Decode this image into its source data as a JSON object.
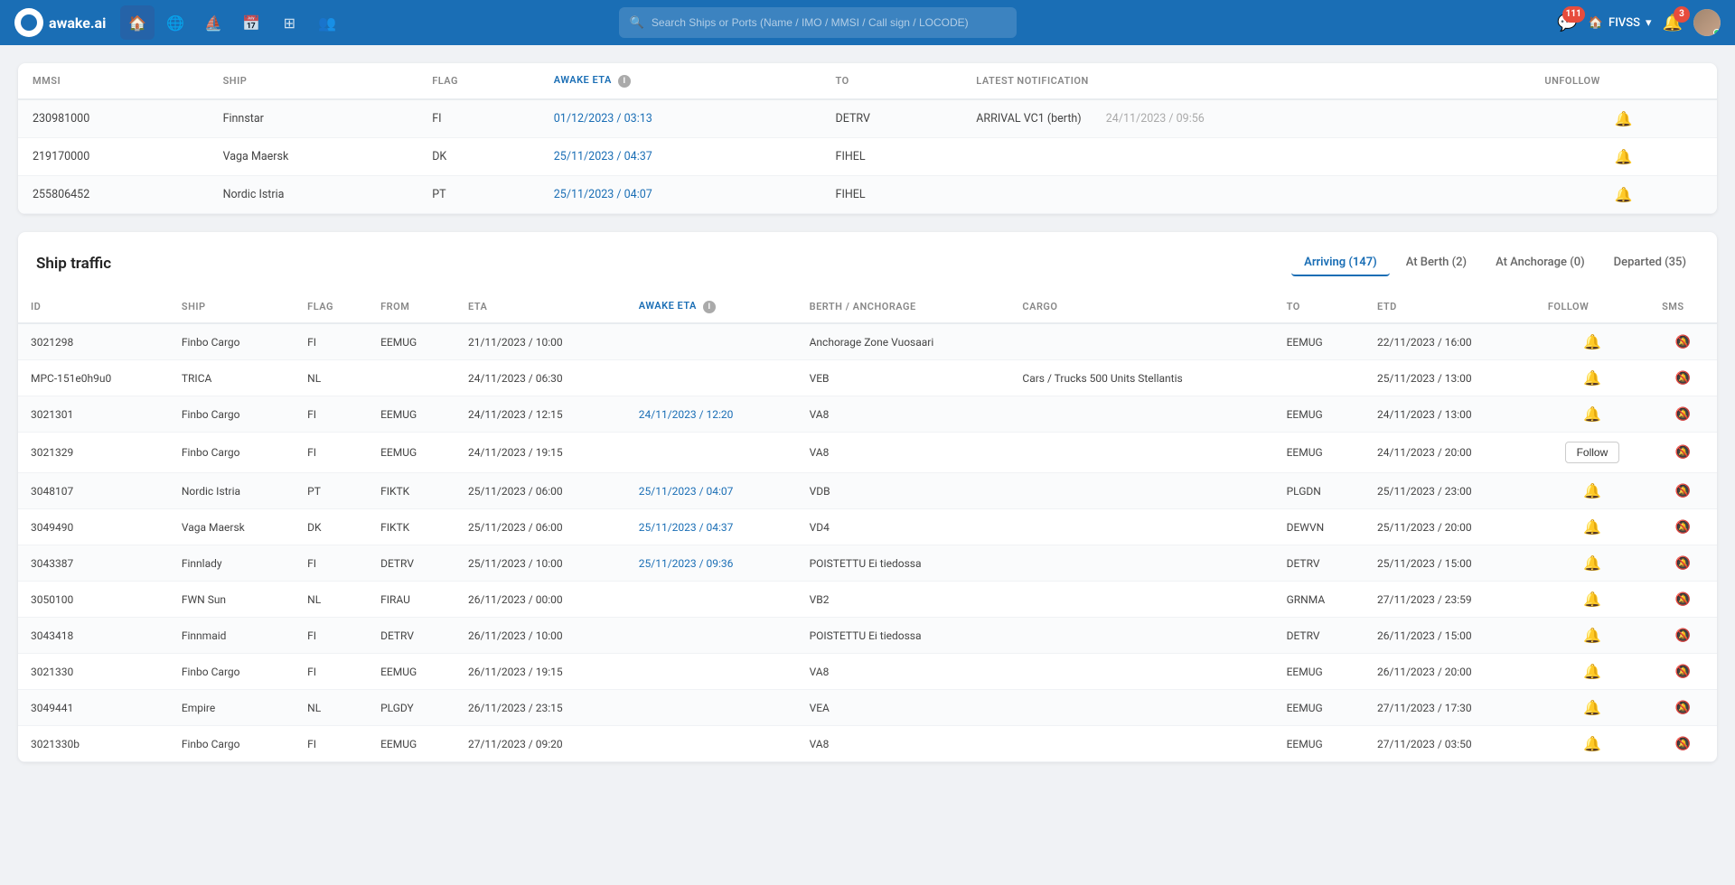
{
  "nav": {
    "logo_text": "awake.ai",
    "search_placeholder": "Search Ships or Ports (Name / IMO / MMSI / Call sign / LOCODE)",
    "notification_count": "111",
    "bell_count": "3",
    "workspace": "FIVSS"
  },
  "followed_table": {
    "columns": [
      "MMSI",
      "SHIP",
      "FLAG",
      "AWAKE ETA",
      "TO",
      "LATEST NOTIFICATION",
      "UNFOLLOW"
    ],
    "rows": [
      {
        "mmsi": "230981000",
        "ship": "Finnstar",
        "flag": "FI",
        "eta": "01/12/2023 / 03:13",
        "to": "DETRV",
        "notification": "ARRIVAL VC1 (berth)",
        "notif_time": "24/11/2023 / 09:56",
        "has_bell_active": true
      },
      {
        "mmsi": "219170000",
        "ship": "Vaga Maersk",
        "flag": "DK",
        "eta": "25/11/2023 / 04:37",
        "to": "FIHEL",
        "notification": "",
        "notif_time": "",
        "has_bell_active": false
      },
      {
        "mmsi": "255806452",
        "ship": "Nordic Istria",
        "flag": "PT",
        "eta": "25/11/2023 / 04:07",
        "to": "FIHEL",
        "notification": "",
        "notif_time": "",
        "has_bell_active": false
      }
    ]
  },
  "ship_traffic": {
    "title": "Ship traffic",
    "tabs": [
      {
        "label": "Arriving (147)",
        "active": true
      },
      {
        "label": "At Berth (2)",
        "active": false
      },
      {
        "label": "At Anchorage (0)",
        "active": false
      },
      {
        "label": "Departed (35)",
        "active": false
      }
    ],
    "columns": [
      "ID",
      "SHIP",
      "FLAG",
      "FROM",
      "ETA",
      "AWAKE ETA",
      "BERTH / ANCHORAGE",
      "CARGO",
      "TO",
      "ETD",
      "FOLLOW",
      "SMS"
    ],
    "rows": [
      {
        "id": "3021298",
        "ship": "Finbo Cargo",
        "flag": "FI",
        "from": "EEMUG",
        "eta": "21/11/2023 / 10:00",
        "awake_eta": "",
        "berth": "Anchorage Zone Vuosaari",
        "cargo": "",
        "to": "EEMUG",
        "etd": "22/11/2023 / 16:00",
        "follow_btn": false
      },
      {
        "id": "MPC-151e0h9u0",
        "ship": "TRICA",
        "flag": "NL",
        "from": "",
        "eta": "24/11/2023 / 06:30",
        "awake_eta": "",
        "berth": "VEB",
        "cargo": "Cars / Trucks 500 Units Stellantis",
        "to": "",
        "etd": "25/11/2023 / 13:00",
        "follow_btn": false
      },
      {
        "id": "3021301",
        "ship": "Finbo Cargo",
        "flag": "FI",
        "from": "EEMUG",
        "eta": "24/11/2023 / 12:15",
        "awake_eta": "24/11/2023 / 12:20",
        "berth": "VA8",
        "cargo": "",
        "to": "EEMUG",
        "etd": "24/11/2023 / 13:00",
        "follow_btn": false
      },
      {
        "id": "3021329",
        "ship": "Finbo Cargo",
        "flag": "FI",
        "from": "EEMUG",
        "eta": "24/11/2023 / 19:15",
        "awake_eta": "",
        "berth": "VA8",
        "cargo": "",
        "to": "EEMUG",
        "etd": "24/11/2023 / 20:00",
        "follow_btn": true
      },
      {
        "id": "3048107",
        "ship": "Nordic Istria",
        "flag": "PT",
        "from": "FIKTK",
        "eta": "25/11/2023 / 06:00",
        "awake_eta": "25/11/2023 / 04:07",
        "berth": "VDB",
        "cargo": "",
        "to": "PLGDN",
        "etd": "25/11/2023 / 23:00",
        "follow_btn": false
      },
      {
        "id": "3049490",
        "ship": "Vaga Maersk",
        "flag": "DK",
        "from": "FIKTK",
        "eta": "25/11/2023 / 06:00",
        "awake_eta": "25/11/2023 / 04:37",
        "berth": "VD4",
        "cargo": "",
        "to": "DEWVN",
        "etd": "25/11/2023 / 20:00",
        "follow_btn": false
      },
      {
        "id": "3043387",
        "ship": "Finnlady",
        "flag": "FI",
        "from": "DETRV",
        "eta": "25/11/2023 / 10:00",
        "awake_eta": "25/11/2023 / 09:36",
        "berth": "POISTETTU Ei tiedossa",
        "cargo": "",
        "to": "DETRV",
        "etd": "25/11/2023 / 15:00",
        "follow_btn": false
      },
      {
        "id": "3050100",
        "ship": "FWN Sun",
        "flag": "NL",
        "from": "FIRAU",
        "eta": "26/11/2023 / 00:00",
        "awake_eta": "",
        "berth": "VB2",
        "cargo": "",
        "to": "GRNMA",
        "etd": "27/11/2023 / 23:59",
        "follow_btn": false
      },
      {
        "id": "3043418",
        "ship": "Finnmaid",
        "flag": "FI",
        "from": "DETRV",
        "eta": "26/11/2023 / 10:00",
        "awake_eta": "",
        "berth": "POISTETTU Ei tiedossa",
        "cargo": "",
        "to": "DETRV",
        "etd": "26/11/2023 / 15:00",
        "follow_btn": false
      },
      {
        "id": "3021330",
        "ship": "Finbo Cargo",
        "flag": "FI",
        "from": "EEMUG",
        "eta": "26/11/2023 / 19:15",
        "awake_eta": "",
        "berth": "VA8",
        "cargo": "",
        "to": "EEMUG",
        "etd": "26/11/2023 / 20:00",
        "follow_btn": false
      },
      {
        "id": "3049441",
        "ship": "Empire",
        "flag": "NL",
        "from": "PLGDY",
        "eta": "26/11/2023 / 23:15",
        "awake_eta": "",
        "berth": "VEA",
        "cargo": "",
        "to": "EEMUG",
        "etd": "27/11/2023 / 17:30",
        "follow_btn": false
      },
      {
        "id": "3021330b",
        "ship": "Finbo Cargo",
        "flag": "FI",
        "from": "EEMUG",
        "eta": "27/11/2023 / 09:20",
        "awake_eta": "",
        "berth": "VA8",
        "cargo": "",
        "to": "EEMUG",
        "etd": "27/11/2023 / 03:50",
        "follow_btn": false
      }
    ],
    "follow_label": "Follow"
  }
}
